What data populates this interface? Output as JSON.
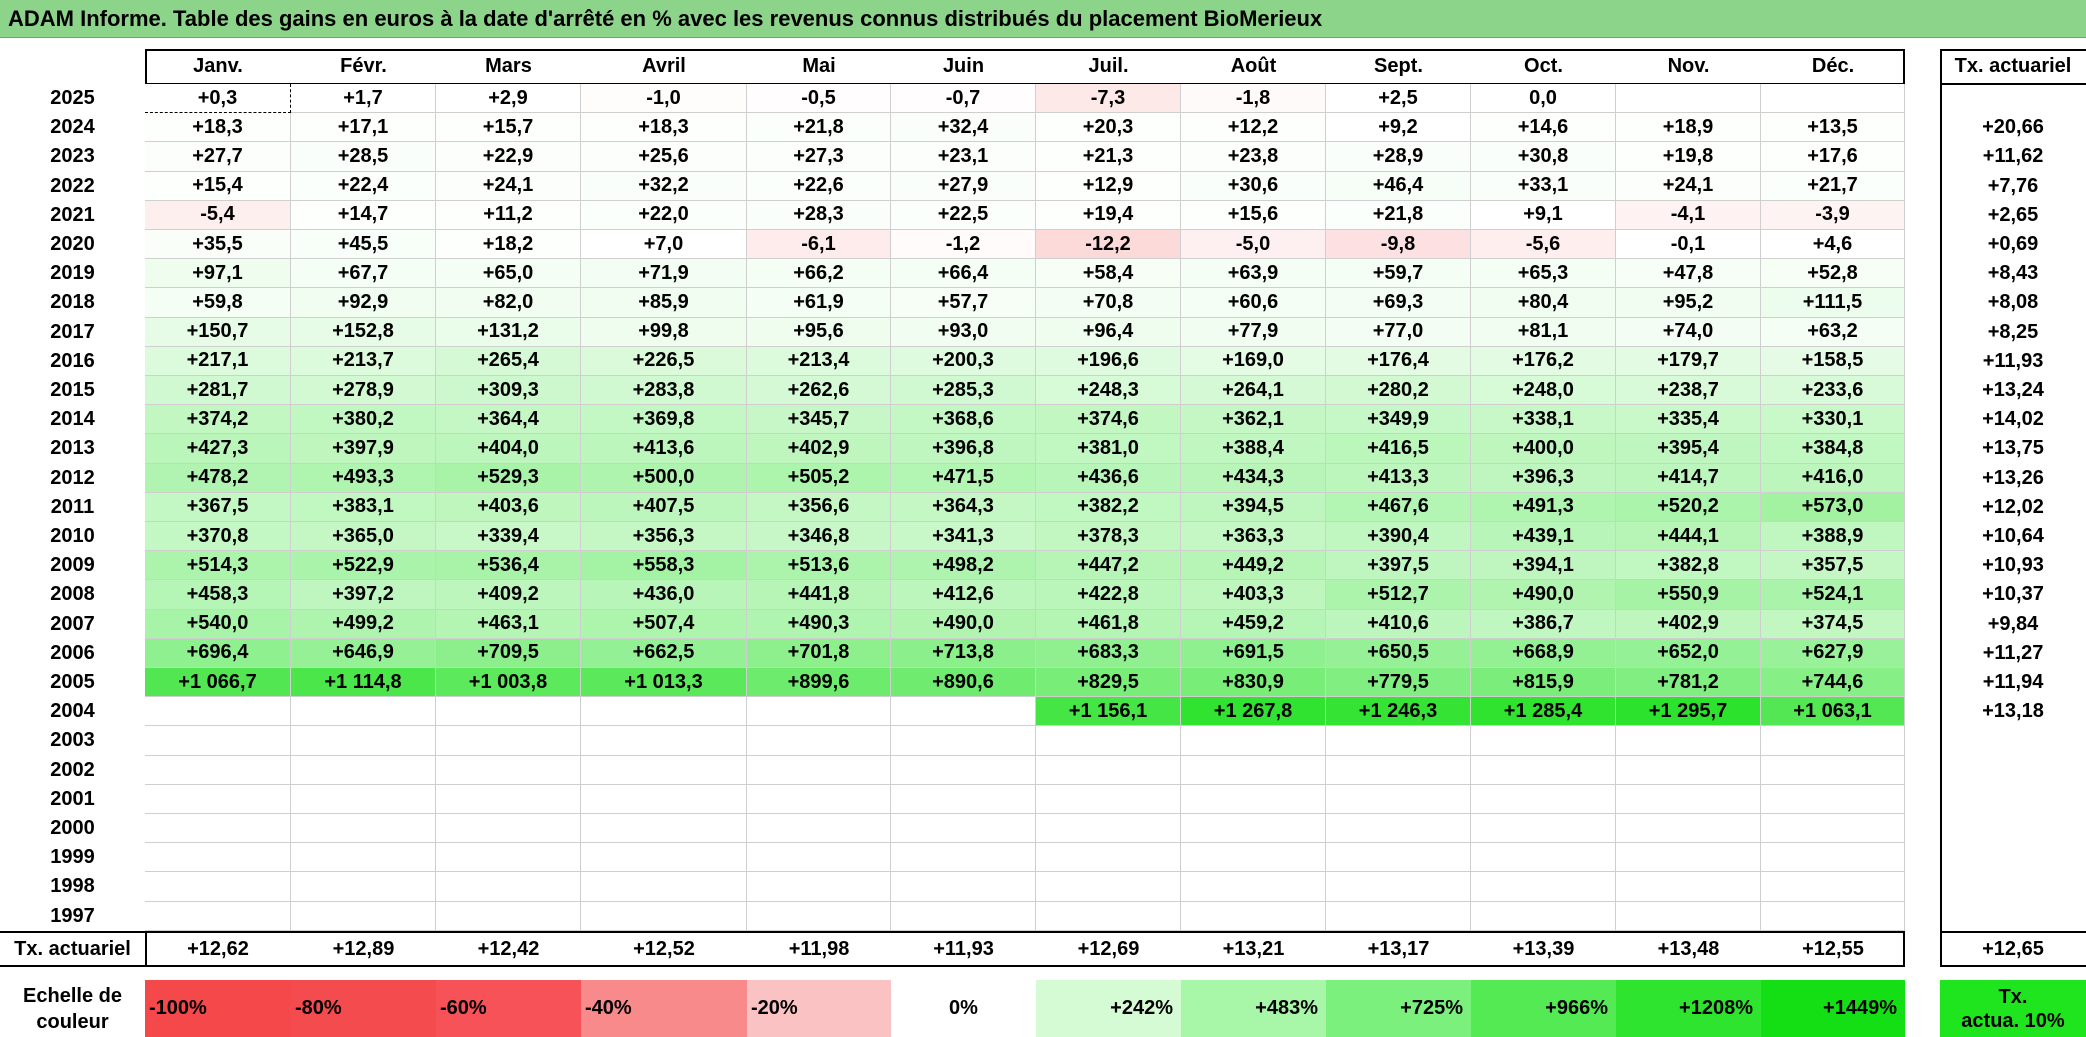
{
  "title": "ADAM Informe. Table des gains en euros à la date d'arrêté en % avec les revenus connus distribués du placement BioMerieux",
  "months": [
    "Janv.",
    "Févr.",
    "Mars",
    "Avril",
    "Mai",
    "Juin",
    "Juil.",
    "Août",
    "Sept.",
    "Oct.",
    "Nov.",
    "Déc."
  ],
  "actuarial_header": "Tx. actuariel",
  "rows": [
    {
      "year": "2025",
      "values": [
        "+0,3",
        "+1,7",
        "+2,9",
        "-1,0",
        "-0,5",
        "-0,7",
        "-7,3",
        "-1,8",
        "+2,5",
        "0,0",
        "",
        ""
      ],
      "rate": ""
    },
    {
      "year": "2024",
      "values": [
        "+18,3",
        "+17,1",
        "+15,7",
        "+18,3",
        "+21,8",
        "+32,4",
        "+20,3",
        "+12,2",
        "+9,2",
        "+14,6",
        "+18,9",
        "+13,5"
      ],
      "rate": "+20,66"
    },
    {
      "year": "2023",
      "values": [
        "+27,7",
        "+28,5",
        "+22,9",
        "+25,6",
        "+27,3",
        "+23,1",
        "+21,3",
        "+23,8",
        "+28,9",
        "+30,8",
        "+19,8",
        "+17,6"
      ],
      "rate": "+11,62"
    },
    {
      "year": "2022",
      "values": [
        "+15,4",
        "+22,4",
        "+24,1",
        "+32,2",
        "+22,6",
        "+27,9",
        "+12,9",
        "+30,6",
        "+46,4",
        "+33,1",
        "+24,1",
        "+21,7"
      ],
      "rate": "+7,76"
    },
    {
      "year": "2021",
      "values": [
        "-5,4",
        "+14,7",
        "+11,2",
        "+22,0",
        "+28,3",
        "+22,5",
        "+19,4",
        "+15,6",
        "+21,8",
        "+9,1",
        "-4,1",
        "-3,9"
      ],
      "rate": "+2,65"
    },
    {
      "year": "2020",
      "values": [
        "+35,5",
        "+45,5",
        "+18,2",
        "+7,0",
        "-6,1",
        "-1,2",
        "-12,2",
        "-5,0",
        "-9,8",
        "-5,6",
        "-0,1",
        "+4,6"
      ],
      "rate": "+0,69"
    },
    {
      "year": "2019",
      "values": [
        "+97,1",
        "+67,7",
        "+65,0",
        "+71,9",
        "+66,2",
        "+66,4",
        "+58,4",
        "+63,9",
        "+59,7",
        "+65,3",
        "+47,8",
        "+52,8"
      ],
      "rate": "+8,43"
    },
    {
      "year": "2018",
      "values": [
        "+59,8",
        "+92,9",
        "+82,0",
        "+85,9",
        "+61,9",
        "+57,7",
        "+70,8",
        "+60,6",
        "+69,3",
        "+80,4",
        "+95,2",
        "+111,5"
      ],
      "rate": "+8,08"
    },
    {
      "year": "2017",
      "values": [
        "+150,7",
        "+152,8",
        "+131,2",
        "+99,8",
        "+95,6",
        "+93,0",
        "+96,4",
        "+77,9",
        "+77,0",
        "+81,1",
        "+74,0",
        "+63,2"
      ],
      "rate": "+8,25"
    },
    {
      "year": "2016",
      "values": [
        "+217,1",
        "+213,7",
        "+265,4",
        "+226,5",
        "+213,4",
        "+200,3",
        "+196,6",
        "+169,0",
        "+176,4",
        "+176,2",
        "+179,7",
        "+158,5"
      ],
      "rate": "+11,93"
    },
    {
      "year": "2015",
      "values": [
        "+281,7",
        "+278,9",
        "+309,3",
        "+283,8",
        "+262,6",
        "+285,3",
        "+248,3",
        "+264,1",
        "+280,2",
        "+248,0",
        "+238,7",
        "+233,6"
      ],
      "rate": "+13,24"
    },
    {
      "year": "2014",
      "values": [
        "+374,2",
        "+380,2",
        "+364,4",
        "+369,8",
        "+345,7",
        "+368,6",
        "+374,6",
        "+362,1",
        "+349,9",
        "+338,1",
        "+335,4",
        "+330,1"
      ],
      "rate": "+14,02"
    },
    {
      "year": "2013",
      "values": [
        "+427,3",
        "+397,9",
        "+404,0",
        "+413,6",
        "+402,9",
        "+396,8",
        "+381,0",
        "+388,4",
        "+416,5",
        "+400,0",
        "+395,4",
        "+384,8"
      ],
      "rate": "+13,75"
    },
    {
      "year": "2012",
      "values": [
        "+478,2",
        "+493,3",
        "+529,3",
        "+500,0",
        "+505,2",
        "+471,5",
        "+436,6",
        "+434,3",
        "+413,3",
        "+396,3",
        "+414,7",
        "+416,0"
      ],
      "rate": "+13,26"
    },
    {
      "year": "2011",
      "values": [
        "+367,5",
        "+383,1",
        "+403,6",
        "+407,5",
        "+356,6",
        "+364,3",
        "+382,2",
        "+394,5",
        "+467,6",
        "+491,3",
        "+520,2",
        "+573,0"
      ],
      "rate": "+12,02"
    },
    {
      "year": "2010",
      "values": [
        "+370,8",
        "+365,0",
        "+339,4",
        "+356,3",
        "+346,8",
        "+341,3",
        "+378,3",
        "+363,3",
        "+390,4",
        "+439,1",
        "+444,1",
        "+388,9"
      ],
      "rate": "+10,64"
    },
    {
      "year": "2009",
      "values": [
        "+514,3",
        "+522,9",
        "+536,4",
        "+558,3",
        "+513,6",
        "+498,2",
        "+447,2",
        "+449,2",
        "+397,5",
        "+394,1",
        "+382,8",
        "+357,5"
      ],
      "rate": "+10,93"
    },
    {
      "year": "2008",
      "values": [
        "+458,3",
        "+397,2",
        "+409,2",
        "+436,0",
        "+441,8",
        "+412,6",
        "+422,8",
        "+403,3",
        "+512,7",
        "+490,0",
        "+550,9",
        "+524,1"
      ],
      "rate": "+10,37"
    },
    {
      "year": "2007",
      "values": [
        "+540,0",
        "+499,2",
        "+463,1",
        "+507,4",
        "+490,3",
        "+490,0",
        "+461,8",
        "+459,2",
        "+410,6",
        "+386,7",
        "+402,9",
        "+374,5"
      ],
      "rate": "+9,84"
    },
    {
      "year": "2006",
      "values": [
        "+696,4",
        "+646,9",
        "+709,5",
        "+662,5",
        "+701,8",
        "+713,8",
        "+683,3",
        "+691,5",
        "+650,5",
        "+668,9",
        "+652,0",
        "+627,9"
      ],
      "rate": "+11,27"
    },
    {
      "year": "2005",
      "values": [
        "+1 066,7",
        "+1 114,8",
        "+1 003,8",
        "+1 013,3",
        "+899,6",
        "+890,6",
        "+829,5",
        "+830,9",
        "+779,5",
        "+815,9",
        "+781,2",
        "+744,6"
      ],
      "rate": "+11,94"
    },
    {
      "year": "2004",
      "values": [
        "",
        "",
        "",
        "",
        "",
        "",
        "+1 156,1",
        "+1 267,8",
        "+1 246,3",
        "+1 285,4",
        "+1 295,7",
        "+1 063,1"
      ],
      "rate": "+13,18"
    },
    {
      "year": "2003",
      "values": [
        "",
        "",
        "",
        "",
        "",
        "",
        "",
        "",
        "",
        "",
        "",
        ""
      ],
      "rate": ""
    },
    {
      "year": "2002",
      "values": [
        "",
        "",
        "",
        "",
        "",
        "",
        "",
        "",
        "",
        "",
        "",
        ""
      ],
      "rate": ""
    },
    {
      "year": "2001",
      "values": [
        "",
        "",
        "",
        "",
        "",
        "",
        "",
        "",
        "",
        "",
        "",
        ""
      ],
      "rate": ""
    },
    {
      "year": "2000",
      "values": [
        "",
        "",
        "",
        "",
        "",
        "",
        "",
        "",
        "",
        "",
        "",
        ""
      ],
      "rate": ""
    },
    {
      "year": "1999",
      "values": [
        "",
        "",
        "",
        "",
        "",
        "",
        "",
        "",
        "",
        "",
        "",
        ""
      ],
      "rate": ""
    },
    {
      "year": "1998",
      "values": [
        "",
        "",
        "",
        "",
        "",
        "",
        "",
        "",
        "",
        "",
        "",
        ""
      ],
      "rate": ""
    },
    {
      "year": "1997",
      "values": [
        "",
        "",
        "",
        "",
        "",
        "",
        "",
        "",
        "",
        "",
        "",
        ""
      ],
      "rate": ""
    }
  ],
  "footer": {
    "label": "Tx. actuariel",
    "values": [
      "+12,62",
      "+12,89",
      "+12,42",
      "+12,52",
      "+11,98",
      "+11,93",
      "+12,69",
      "+13,21",
      "+13,17",
      "+13,39",
      "+13,48",
      "+12,55"
    ],
    "rate": "+12,65"
  },
  "scale": {
    "label_line1": "Echelle de",
    "label_line2": "couleur",
    "items": [
      {
        "text": "-100%",
        "color": "#f4484a"
      },
      {
        "text": "-80%",
        "color": "#f44c4e"
      },
      {
        "text": "-60%",
        "color": "#f65257"
      },
      {
        "text": "-40%",
        "color": "#f88a8c"
      },
      {
        "text": "-20%",
        "color": "#fbc2c3"
      },
      {
        "text": "0%",
        "color": "#ffffff"
      },
      {
        "text": "+242%",
        "color": "#d4fbd4"
      },
      {
        "text": "+483%",
        "color": "#a8f7a8"
      },
      {
        "text": "+725%",
        "color": "#7cf07c"
      },
      {
        "text": "+966%",
        "color": "#54ea54"
      },
      {
        "text": "+1208%",
        "color": "#2ee42e"
      },
      {
        "text": "+1449%",
        "color": "#14df14"
      }
    ],
    "tx_line1": "Tx.",
    "tx_line2": "actua. 10%",
    "tx_color": "#1ee51e"
  }
}
